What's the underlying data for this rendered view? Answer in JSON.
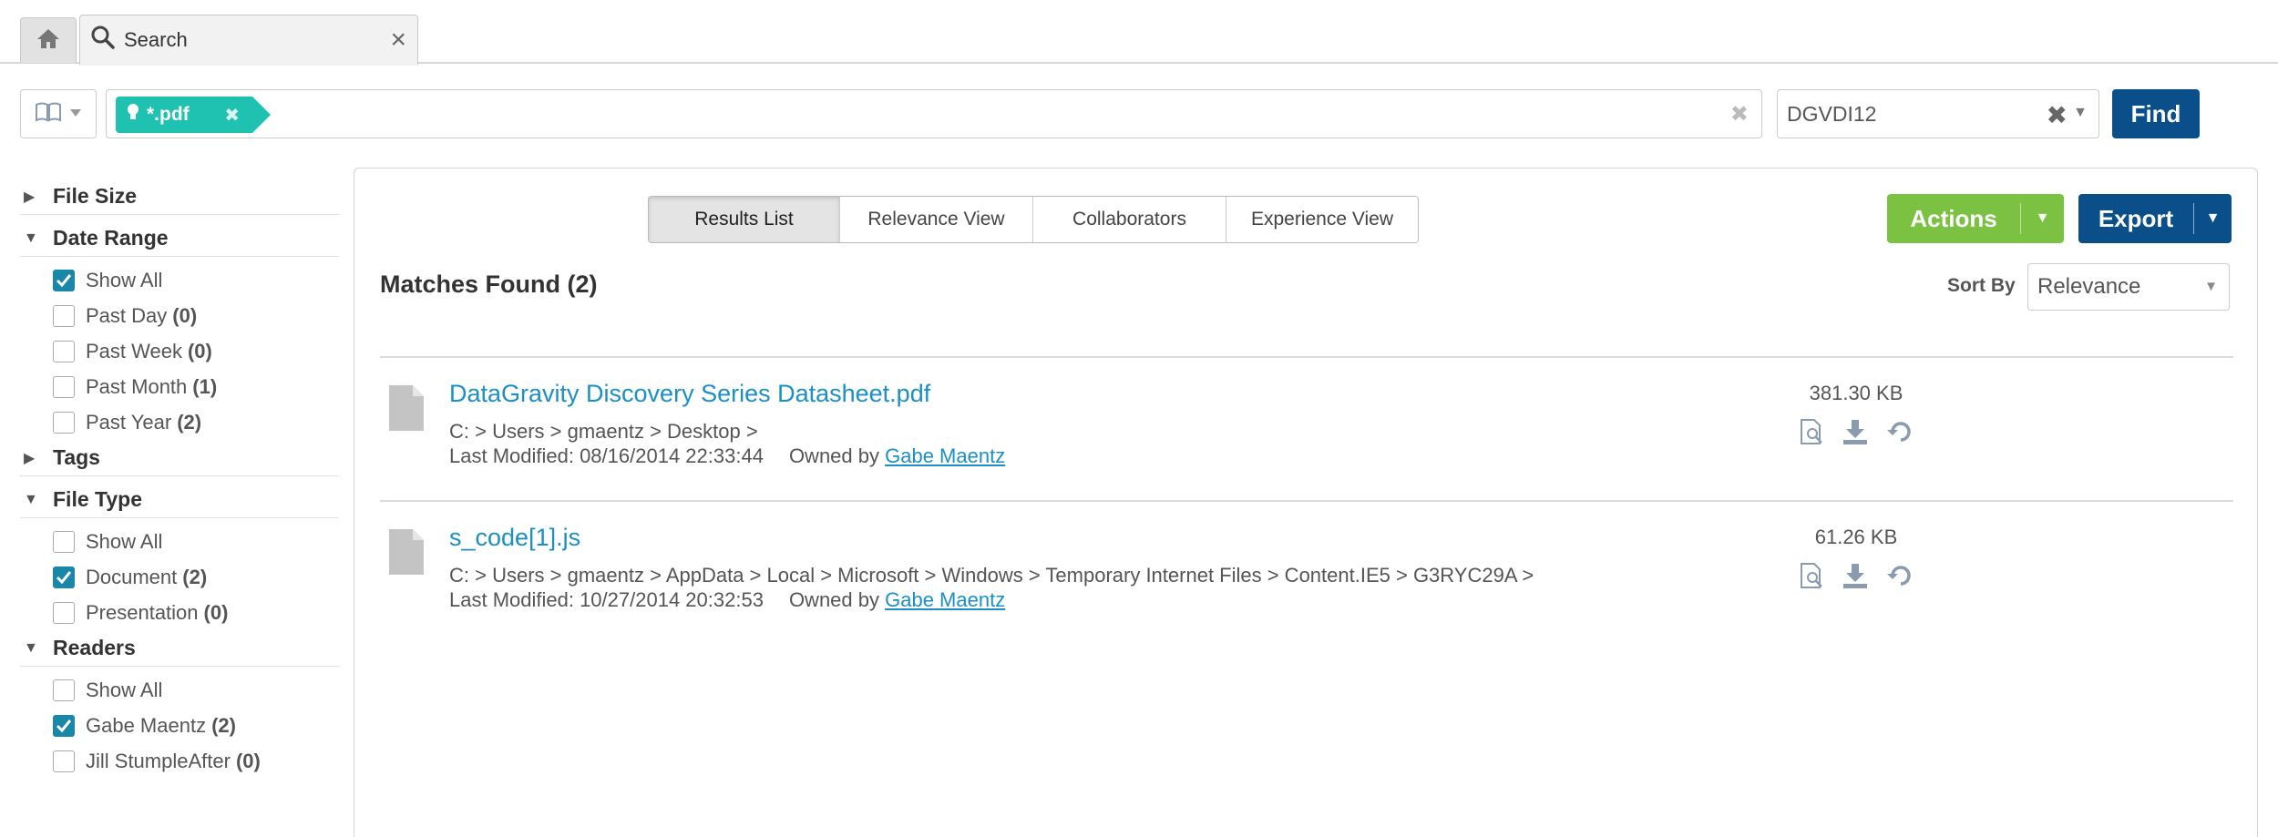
{
  "tabs": {
    "search_label": "Search",
    "close_glyph": "×"
  },
  "query": {
    "tag_label": "*.pdf",
    "tag_remove_glyph": "✖",
    "clear_glyph": "✖",
    "domain_value": "DGVDI12",
    "domain_clear_glyph": "✖",
    "find_label": "Find"
  },
  "sidebar": {
    "facets": [
      {
        "name": "File Size",
        "expanded": false,
        "items": []
      },
      {
        "name": "Date Range",
        "expanded": true,
        "items": [
          {
            "label": "Show All",
            "count": "",
            "checked": true
          },
          {
            "label": "Past Day",
            "count": "(0)",
            "checked": false
          },
          {
            "label": "Past Week",
            "count": "(0)",
            "checked": false
          },
          {
            "label": "Past Month",
            "count": "(1)",
            "checked": false
          },
          {
            "label": "Past Year",
            "count": "(2)",
            "checked": false
          }
        ]
      },
      {
        "name": "Tags",
        "expanded": false,
        "items": []
      },
      {
        "name": "File Type",
        "expanded": true,
        "items": [
          {
            "label": "Show All",
            "count": "",
            "checked": false
          },
          {
            "label": "Document",
            "count": "(2)",
            "checked": true
          },
          {
            "label": "Presentation",
            "count": "(0)",
            "checked": false
          }
        ]
      },
      {
        "name": "Readers",
        "expanded": true,
        "items": [
          {
            "label": "Show All",
            "count": "",
            "checked": false
          },
          {
            "label": "Gabe Maentz",
            "count": "(2)",
            "checked": true
          },
          {
            "label": "Jill StumpleAfter",
            "count": "(0)",
            "checked": false
          }
        ]
      }
    ]
  },
  "main": {
    "view_tabs": [
      "Results List",
      "Relevance View",
      "Collaborators",
      "Experience View"
    ],
    "active_view": "Results List",
    "actions_label": "Actions",
    "export_label": "Export",
    "matches_label": "Matches Found (2)",
    "sort_by_label": "Sort By",
    "sort_value": "Relevance",
    "results": [
      {
        "title": "DataGravity Discovery Series Datasheet.pdf",
        "path": "C: > Users > gmaentz > Desktop >",
        "modified": "Last Modified: 08/16/2014 22:33:44",
        "owned_by": "Owned by",
        "owner": "Gabe Maentz",
        "size": "381.30 KB"
      },
      {
        "title": "s_code[1].js",
        "path": "C: > Users > gmaentz > AppData > Local > Microsoft > Windows > Temporary Internet Files > Content.IE5 > G3RYC29A >",
        "modified": "Last Modified: 10/27/2014 20:32:53",
        "owned_by": "Owned by",
        "owner": "Gabe Maentz",
        "size": "61.26 KB"
      }
    ]
  },
  "colors": {
    "accent_teal": "#1fc2b0",
    "primary_blue": "#0b4f8a",
    "action_green": "#7cc242",
    "link_blue": "#1b8fc6",
    "checkbox_blue": "#1a86a8"
  }
}
